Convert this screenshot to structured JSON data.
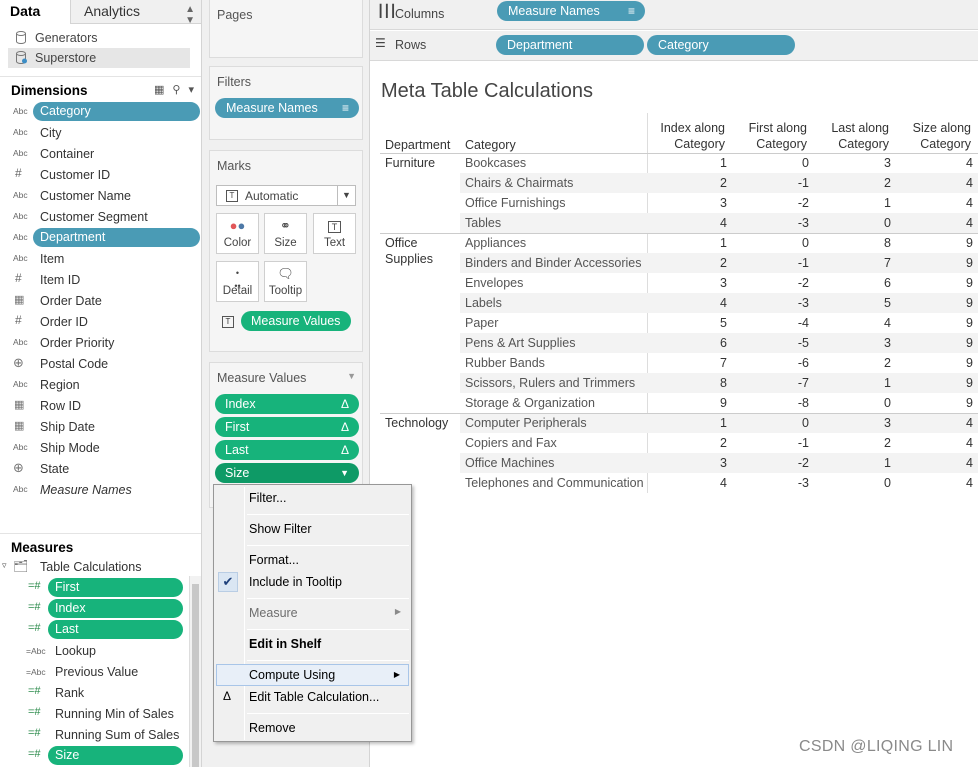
{
  "data_pane": {
    "tab_data": "Data",
    "tab_analytics": "Analytics",
    "datasources": [
      "Generators",
      "Superstore"
    ],
    "dimensions_title": "Dimensions",
    "dimensions": [
      {
        "type": "Abc",
        "name": "Category"
      },
      {
        "type": "Abc",
        "name": "City"
      },
      {
        "type": "Abc",
        "name": "Container"
      },
      {
        "type": "#",
        "name": "Customer ID"
      },
      {
        "type": "Abc",
        "name": "Customer Name"
      },
      {
        "type": "Abc",
        "name": "Customer Segment"
      },
      {
        "type": "Abc",
        "name": "Department"
      },
      {
        "type": "Abc",
        "name": "Item"
      },
      {
        "type": "#",
        "name": "Item ID"
      },
      {
        "type": "date",
        "name": "Order Date"
      },
      {
        "type": "#",
        "name": "Order ID"
      },
      {
        "type": "Abc",
        "name": "Order Priority"
      },
      {
        "type": "globe",
        "name": "Postal Code"
      },
      {
        "type": "Abc",
        "name": "Region"
      },
      {
        "type": "date",
        "name": "Row ID"
      },
      {
        "type": "date",
        "name": "Ship Date"
      },
      {
        "type": "Abc",
        "name": "Ship Mode"
      },
      {
        "type": "globe",
        "name": "State"
      },
      {
        "type": "Abc",
        "name": "Measure Names"
      }
    ],
    "measures_title": "Measures",
    "measures_folder": "Table Calculations",
    "measures": [
      {
        "type": "=#",
        "name": "First"
      },
      {
        "type": "=#",
        "name": "Index"
      },
      {
        "type": "=#",
        "name": "Last"
      },
      {
        "type": "=Abc",
        "name": "Lookup"
      },
      {
        "type": "=Abc",
        "name": "Previous Value"
      },
      {
        "type": "=#",
        "name": "Rank"
      },
      {
        "type": "=#",
        "name": "Running Min of Sales"
      },
      {
        "type": "=#",
        "name": "Running Sum of Sales"
      },
      {
        "type": "=#",
        "name": "Size"
      }
    ]
  },
  "shelves": {
    "pages": "Pages",
    "filters": "Filters",
    "filters_pill": "Measure Names",
    "marks": "Marks",
    "mark_type": "Automatic",
    "mark_buttons": [
      "Color",
      "Size",
      "Text",
      "Detail",
      "Tooltip"
    ],
    "marks_pill": "Measure Values",
    "measure_values_title": "Measure Values",
    "measure_values_pills": [
      "Index",
      "First",
      "Last",
      "Size"
    ],
    "columns_label": "Columns",
    "columns_pill": "Measure Names",
    "rows_label": "Rows",
    "rows_pills": [
      "Department",
      "Category"
    ]
  },
  "viz": {
    "title": "Meta Table Calculations",
    "headers": {
      "department": "Department",
      "category": "Category",
      "index_1": "Index along",
      "index_2": "Category",
      "first_1": "First along",
      "first_2": "Category",
      "last_1": "Last along",
      "last_2": "Category",
      "size_1": "Size along",
      "size_2": "Category"
    },
    "dept_labels": [
      "Furniture",
      "Office",
      "Supplies",
      "Technology"
    ],
    "rows": [
      {
        "cat": "Bookcases",
        "index": "1",
        "first": "0",
        "last": "3",
        "size": "4"
      },
      {
        "cat": "Chairs & Chairmats",
        "index": "2",
        "first": "-1",
        "last": "2",
        "size": "4"
      },
      {
        "cat": "Office Furnishings",
        "index": "3",
        "first": "-2",
        "last": "1",
        "size": "4"
      },
      {
        "cat": "Tables",
        "index": "4",
        "first": "-3",
        "last": "0",
        "size": "4"
      },
      {
        "cat": "Appliances",
        "index": "1",
        "first": "0",
        "last": "8",
        "size": "9"
      },
      {
        "cat": "Binders and Binder Accessories",
        "index": "2",
        "first": "-1",
        "last": "7",
        "size": "9"
      },
      {
        "cat": "Envelopes",
        "index": "3",
        "first": "-2",
        "last": "6",
        "size": "9"
      },
      {
        "cat": "Labels",
        "index": "4",
        "first": "-3",
        "last": "5",
        "size": "9"
      },
      {
        "cat": "Paper",
        "index": "5",
        "first": "-4",
        "last": "4",
        "size": "9"
      },
      {
        "cat": "Pens & Art Supplies",
        "index": "6",
        "first": "-5",
        "last": "3",
        "size": "9"
      },
      {
        "cat": "Rubber Bands",
        "index": "7",
        "first": "-6",
        "last": "2",
        "size": "9"
      },
      {
        "cat": "Scissors, Rulers and Trimmers",
        "index": "8",
        "first": "-7",
        "last": "1",
        "size": "9"
      },
      {
        "cat": "Storage & Organization",
        "index": "9",
        "first": "-8",
        "last": "0",
        "size": "9"
      },
      {
        "cat": "Computer Peripherals",
        "index": "1",
        "first": "0",
        "last": "3",
        "size": "4"
      },
      {
        "cat": "Copiers and Fax",
        "index": "2",
        "first": "-1",
        "last": "2",
        "size": "4"
      },
      {
        "cat": "Office Machines",
        "index": "3",
        "first": "-2",
        "last": "1",
        "size": "4"
      },
      {
        "cat": "Telephones and Communication",
        "index": "4",
        "first": "-3",
        "last": "0",
        "size": "4"
      }
    ]
  },
  "context_menu": {
    "filter": "Filter...",
    "show_filter": "Show Filter",
    "format": "Format...",
    "include_tooltip": "Include in Tooltip",
    "measure": "Measure",
    "edit_in_shelf": "Edit in Shelf",
    "compute_using": "Compute Using",
    "edit_table_calc": "Edit Table Calculation...",
    "remove": "Remove"
  },
  "watermark": "CSDN @LIQING LIN",
  "colors": {
    "dimension_pill": "#4a9bb5",
    "measure_pill": "#17b37b",
    "menu_highlight": "#e8eff8"
  }
}
